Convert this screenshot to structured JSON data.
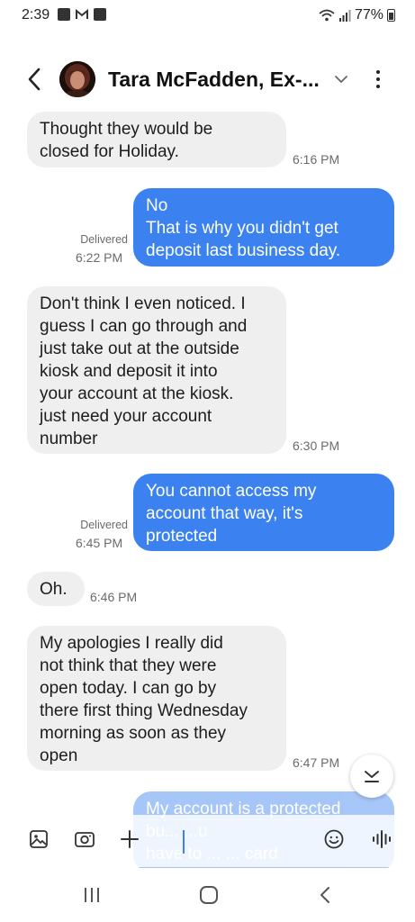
{
  "status_bar": {
    "time": "2:39",
    "battery": "77%"
  },
  "header": {
    "contact_name": "Tara McFadden, Ex-..."
  },
  "messages": [
    {
      "text": "Thought they would be\nclosed for Holiday.",
      "time": "6:16 PM"
    },
    {
      "text": "No\nThat is why you didn't get\ndeposit last business day.",
      "status": "Delivered",
      "time": "6:22 PM"
    },
    {
      "text": "Don't think I even noticed. I\nguess I can go through and\njust take out at the outside\nkiosk and deposit it into\nyour account at the kiosk.\njust need your account\nnumber",
      "time": "6:30 PM"
    },
    {
      "text": "You cannot access my\naccount that way, it's\nprotected",
      "status": "Delivered",
      "time": "6:45 PM"
    },
    {
      "text": "Oh.",
      "time": "6:46 PM"
    },
    {
      "text": "My apologies I really did\nnot think that they were\nopen today. I can go by\nthere first thing Wednesday\nmorning as soon as they\nopen",
      "time": "6:47 PM"
    },
    {
      "text": "My account is a protected\nbu... ...u\nhave to ... ... card"
    }
  ],
  "composer": {
    "value": "",
    "placeholder": ""
  },
  "icons": {
    "back": "chevron-left-icon",
    "more": "more-vert-icon",
    "expand": "chevron-down-icon",
    "gallery": "image-icon",
    "camera": "camera-icon",
    "add": "plus-icon",
    "emoji": "emoji-icon",
    "voice": "voice-wave-icon",
    "scroll": "scroll-down-icon"
  },
  "colors": {
    "outgoing": "#3b82f0",
    "incoming": "#efefef",
    "cursor": "#3b82f0"
  }
}
